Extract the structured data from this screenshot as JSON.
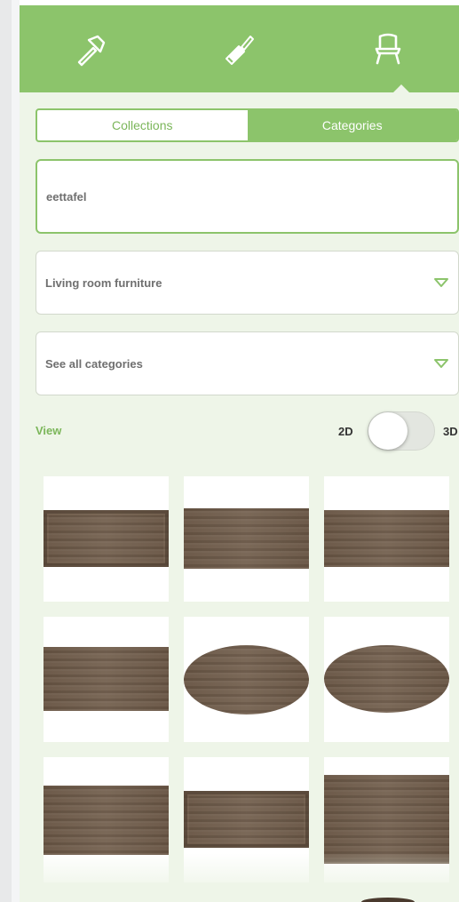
{
  "toolbar": {
    "tools": [
      {
        "name": "hammer",
        "icon": "hammer-icon",
        "active": false
      },
      {
        "name": "paint",
        "icon": "paintbrush-icon",
        "active": false
      },
      {
        "name": "furniture",
        "icon": "chair-icon",
        "active": true
      }
    ]
  },
  "tabs": {
    "collections": "Collections",
    "categories": "Categories",
    "active": "categories"
  },
  "search": {
    "value": "eettafel"
  },
  "filters": {
    "category": "Living room furniture",
    "subcategory": "See all categories"
  },
  "view": {
    "label": "View",
    "option_2d": "2D",
    "option_3d": "3D",
    "mode": "2D"
  },
  "products": [
    {
      "shape": "rect-framed"
    },
    {
      "shape": "rect"
    },
    {
      "shape": "rect"
    },
    {
      "shape": "rect"
    },
    {
      "shape": "oval"
    },
    {
      "shape": "oval"
    },
    {
      "shape": "rect"
    },
    {
      "shape": "rect-framed"
    },
    {
      "shape": "rect"
    }
  ],
  "colors": {
    "accent": "#8cc46b",
    "panel_bg": "#eef5e8",
    "wood": "#6e5a48"
  }
}
